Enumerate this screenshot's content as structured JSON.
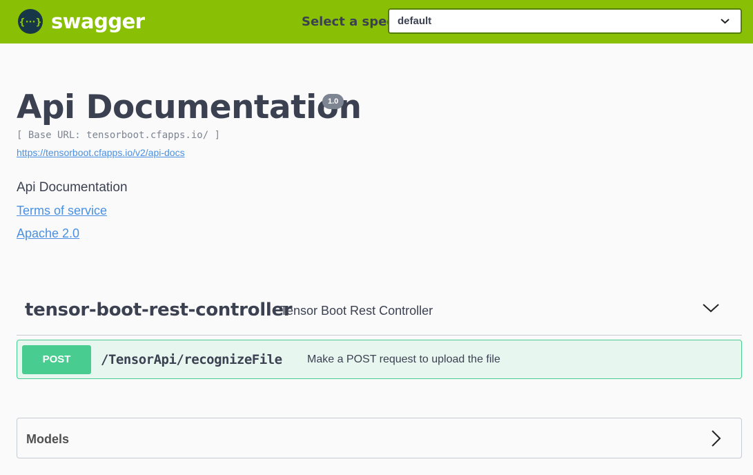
{
  "topbar": {
    "logo_text": "swagger",
    "logo_icon_glyph": "{···}",
    "spec_label": "Select a spec",
    "spec_selected": "default"
  },
  "info": {
    "title": "Api Documentation",
    "version": "1.0",
    "base_url": "[ Base URL: tensorboot.cfapps.io/ ]",
    "spec_url": "https://tensorboot.cfapps.io/v2/api-docs",
    "description": "Api Documentation",
    "terms_label": "Terms of service",
    "license_label": "Apache 2.0"
  },
  "tag": {
    "name": "tensor-boot-rest-controller",
    "description": "Tensor Boot Rest Controller",
    "icon": "chevron-down-icon"
  },
  "operation": {
    "method": "POST",
    "path": "/TensorApi/recognizeFile",
    "summary": "Make a POST request to upload the file"
  },
  "models": {
    "title": "Models",
    "icon": "chevron-right-icon"
  },
  "colors": {
    "topbar": "#89bf04",
    "post": "#49cc90",
    "post_bg": "#e8f6f0",
    "link": "#4990e2",
    "text": "#3b4151"
  }
}
